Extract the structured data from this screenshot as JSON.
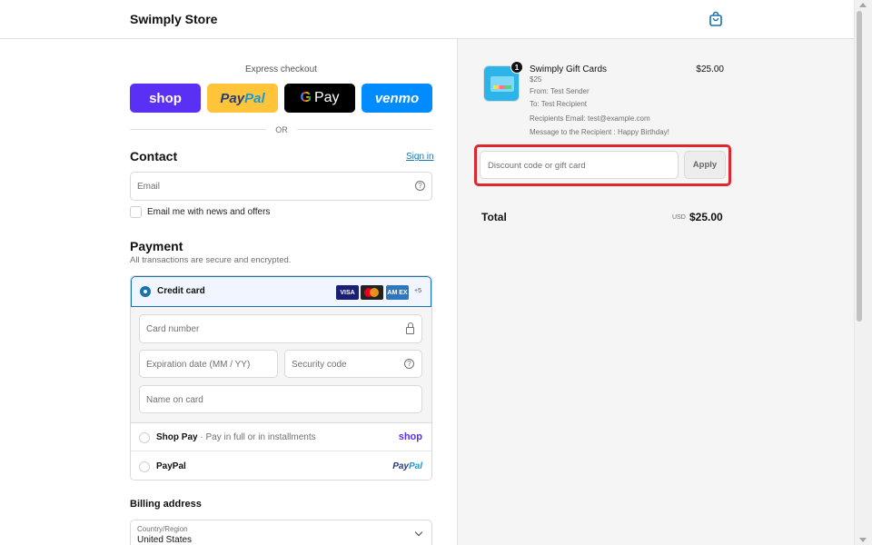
{
  "header": {
    "store_name": "Swimply Store",
    "cart_icon": "shopping-bag-icon"
  },
  "express": {
    "label": "Express checkout",
    "buttons": {
      "shop": "shop",
      "paypal_pay": "Pay",
      "paypal_pal": "Pal",
      "gpay_g": "G",
      "gpay_pay": "Pay",
      "venmo": "venmo"
    },
    "or_text": "OR"
  },
  "contact": {
    "title": "Contact",
    "signin_link": "Sign in",
    "email_placeholder": "Email",
    "newsletter_label": "Email me with news and offers"
  },
  "payment": {
    "title": "Payment",
    "subtitle": "All transactions are secure and encrypted.",
    "credit_card_label": "Credit card",
    "card_brands": {
      "visa": "VISA",
      "amex": "AM EX",
      "more": "+5"
    },
    "card_number_placeholder": "Card number",
    "expiration_placeholder": "Expiration date (MM / YY)",
    "security_placeholder": "Security code",
    "name_placeholder": "Name on card",
    "shop_pay": {
      "name": "Shop Pay",
      "sub": " · Pay in full or in installments",
      "logo": "shop"
    },
    "paypal": {
      "name": "PayPal",
      "logo_pay": "Pay",
      "logo_pal": "Pal"
    }
  },
  "billing": {
    "title": "Billing address",
    "country_label": "Country/Region",
    "country_value": "United States"
  },
  "summary": {
    "quantity": "1",
    "product_name": "Swimply Gift Cards",
    "product_price": "$25.00",
    "variant": "$25",
    "from": "From: Test Sender",
    "to": "To: Test Recipient",
    "recipient_email": "Recipients Email: test@example.com",
    "message": "Message to the Recipient : Happy Birthday!",
    "discount_placeholder": "Discount code or gift card",
    "apply_label": "Apply",
    "total_label": "Total",
    "total_currency": "USD",
    "total_amount": "$25.00"
  },
  "colors": {
    "accent": "#1773b0",
    "highlight_border": "#e0252d",
    "shop_purple": "#5a31f4",
    "paypal_yellow": "#ffc439",
    "venmo_blue": "#008cff"
  }
}
